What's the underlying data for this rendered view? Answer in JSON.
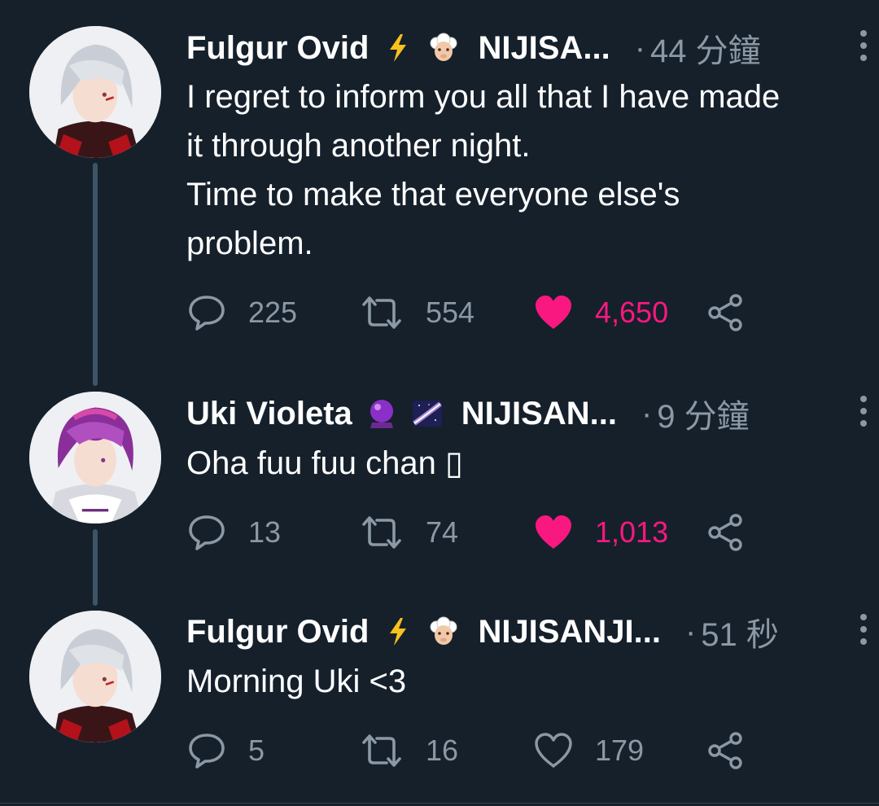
{
  "colors": {
    "background": "#15202b",
    "text_primary": "#ffffff",
    "text_secondary": "#8b98a5",
    "like_active": "#f91880",
    "thread_line": "#3d5466"
  },
  "tweets": [
    {
      "name": "Fulgur Ovid",
      "emojis": [
        "lightning-emoji",
        "sheep-emoji"
      ],
      "handle": "NIJISA...",
      "dot": "·",
      "time": "44 分鐘",
      "lines": [
        "I regret to inform you all that I have made",
        "it through another night.",
        "Time to make that everyone else's",
        "problem."
      ],
      "replies": "225",
      "retweets": "554",
      "likes": "4,650",
      "liked": true,
      "avatar": "silver-haired-avatar"
    },
    {
      "name": "Uki Violeta",
      "emojis": [
        "crystal-ball-emoji",
        "milky-way-emoji"
      ],
      "handle": "NIJISAN...",
      "dot": "·",
      "time": "9 分鐘",
      "lines": [
        "Oha fuu fuu chan ▯"
      ],
      "replies": "13",
      "retweets": "74",
      "likes": "1,013",
      "liked": true,
      "avatar": "purple-haired-avatar"
    },
    {
      "name": "Fulgur Ovid",
      "emojis": [
        "lightning-emoji",
        "sheep-emoji"
      ],
      "handle": "NIJISANJI...",
      "dot": "·",
      "time": "51 秒",
      "lines": [
        "Morning Uki <3"
      ],
      "replies": "5",
      "retweets": "16",
      "likes": "179",
      "liked": false,
      "avatar": "silver-haired-avatar"
    }
  ]
}
